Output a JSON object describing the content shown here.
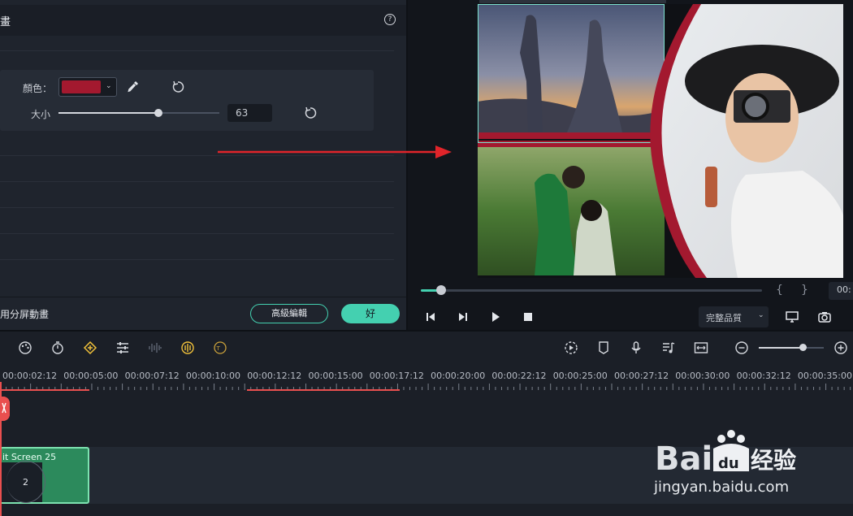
{
  "app": {
    "accent": "#44d0b0",
    "danger": "#e94f4f"
  },
  "left_panel": {
    "title": "畫",
    "help_icon": "?",
    "color_label": "顏色：",
    "color_value": "#a3192f",
    "size_label": "大小",
    "size_value": "63",
    "size_fraction": 0.62,
    "apply_label": "用分屏動畫",
    "advanced_label": "高級編輯",
    "ok_label": "好"
  },
  "preview": {
    "progress_fraction": 0.05,
    "brace_open": "{",
    "brace_close": "}",
    "time_readout": "00:",
    "quality_label": "完整品質",
    "controls": [
      "prev-frame-icon",
      "next-frame-icon",
      "play-icon",
      "stop-icon"
    ],
    "right_icons": [
      "monitor-icon",
      "snapshot-icon"
    ]
  },
  "toolbar": {
    "icons": [
      "color-palette-icon",
      "speed-icon",
      "keyframe-icon",
      "adjust-icon",
      "audio-wave-icon",
      "audio-stretch-icon",
      "speech-to-text-icon",
      "render-icon",
      "marker-icon",
      "microphone-icon",
      "music-icon",
      "fit-icon",
      "zoom-out-icon",
      "zoom-in-icon"
    ],
    "zoom_fraction": 0.67
  },
  "ruler": {
    "labels": [
      "00:00:02:12",
      "00:00:05:00",
      "00:00:07:12",
      "00:00:10:00",
      "00:00:12:12",
      "00:00:15:00",
      "00:00:17:12",
      "00:00:20:00",
      "00:00:22:12",
      "00:00:25:00",
      "00:00:27:12",
      "00:00:30:00",
      "00:00:32:12",
      "00:00:35:00"
    ]
  },
  "clip": {
    "title": "it Screen 25",
    "count": "2"
  },
  "watermark": {
    "brand": "Baidu经验",
    "url": "jingyan.baidu.com"
  }
}
